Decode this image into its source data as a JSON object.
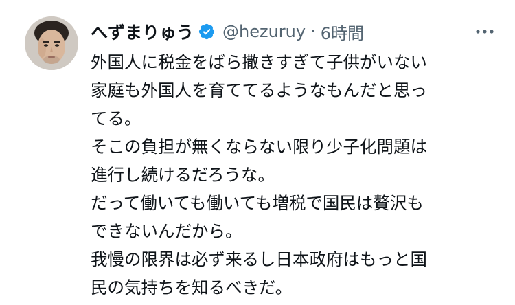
{
  "tweet": {
    "display_name": "へずまりゅう",
    "handle": "@hezuruy",
    "separator": "·",
    "time": "6時間",
    "body": "外国人に税金をばら撒きすぎて子供がいない\n家庭も外国人を育ててるようなもんだと思っ\nてる。\nそこの負担が無くならない限り少子化問題は\n進行し続けるだろうな。\nだって働いても働いても増税で国民は贅沢も\nできないんだから。\n我慢の限界は必ず来るし日本政府はもっと国\n民の気持ちを知るべきだ。"
  },
  "colors": {
    "text_primary": "#0f1419",
    "text_secondary": "#536471",
    "verified_badge": "#1d9bf0",
    "background": "#ffffff"
  },
  "icons": {
    "verified": "verified-badge-icon",
    "more": "more-options-icon"
  }
}
